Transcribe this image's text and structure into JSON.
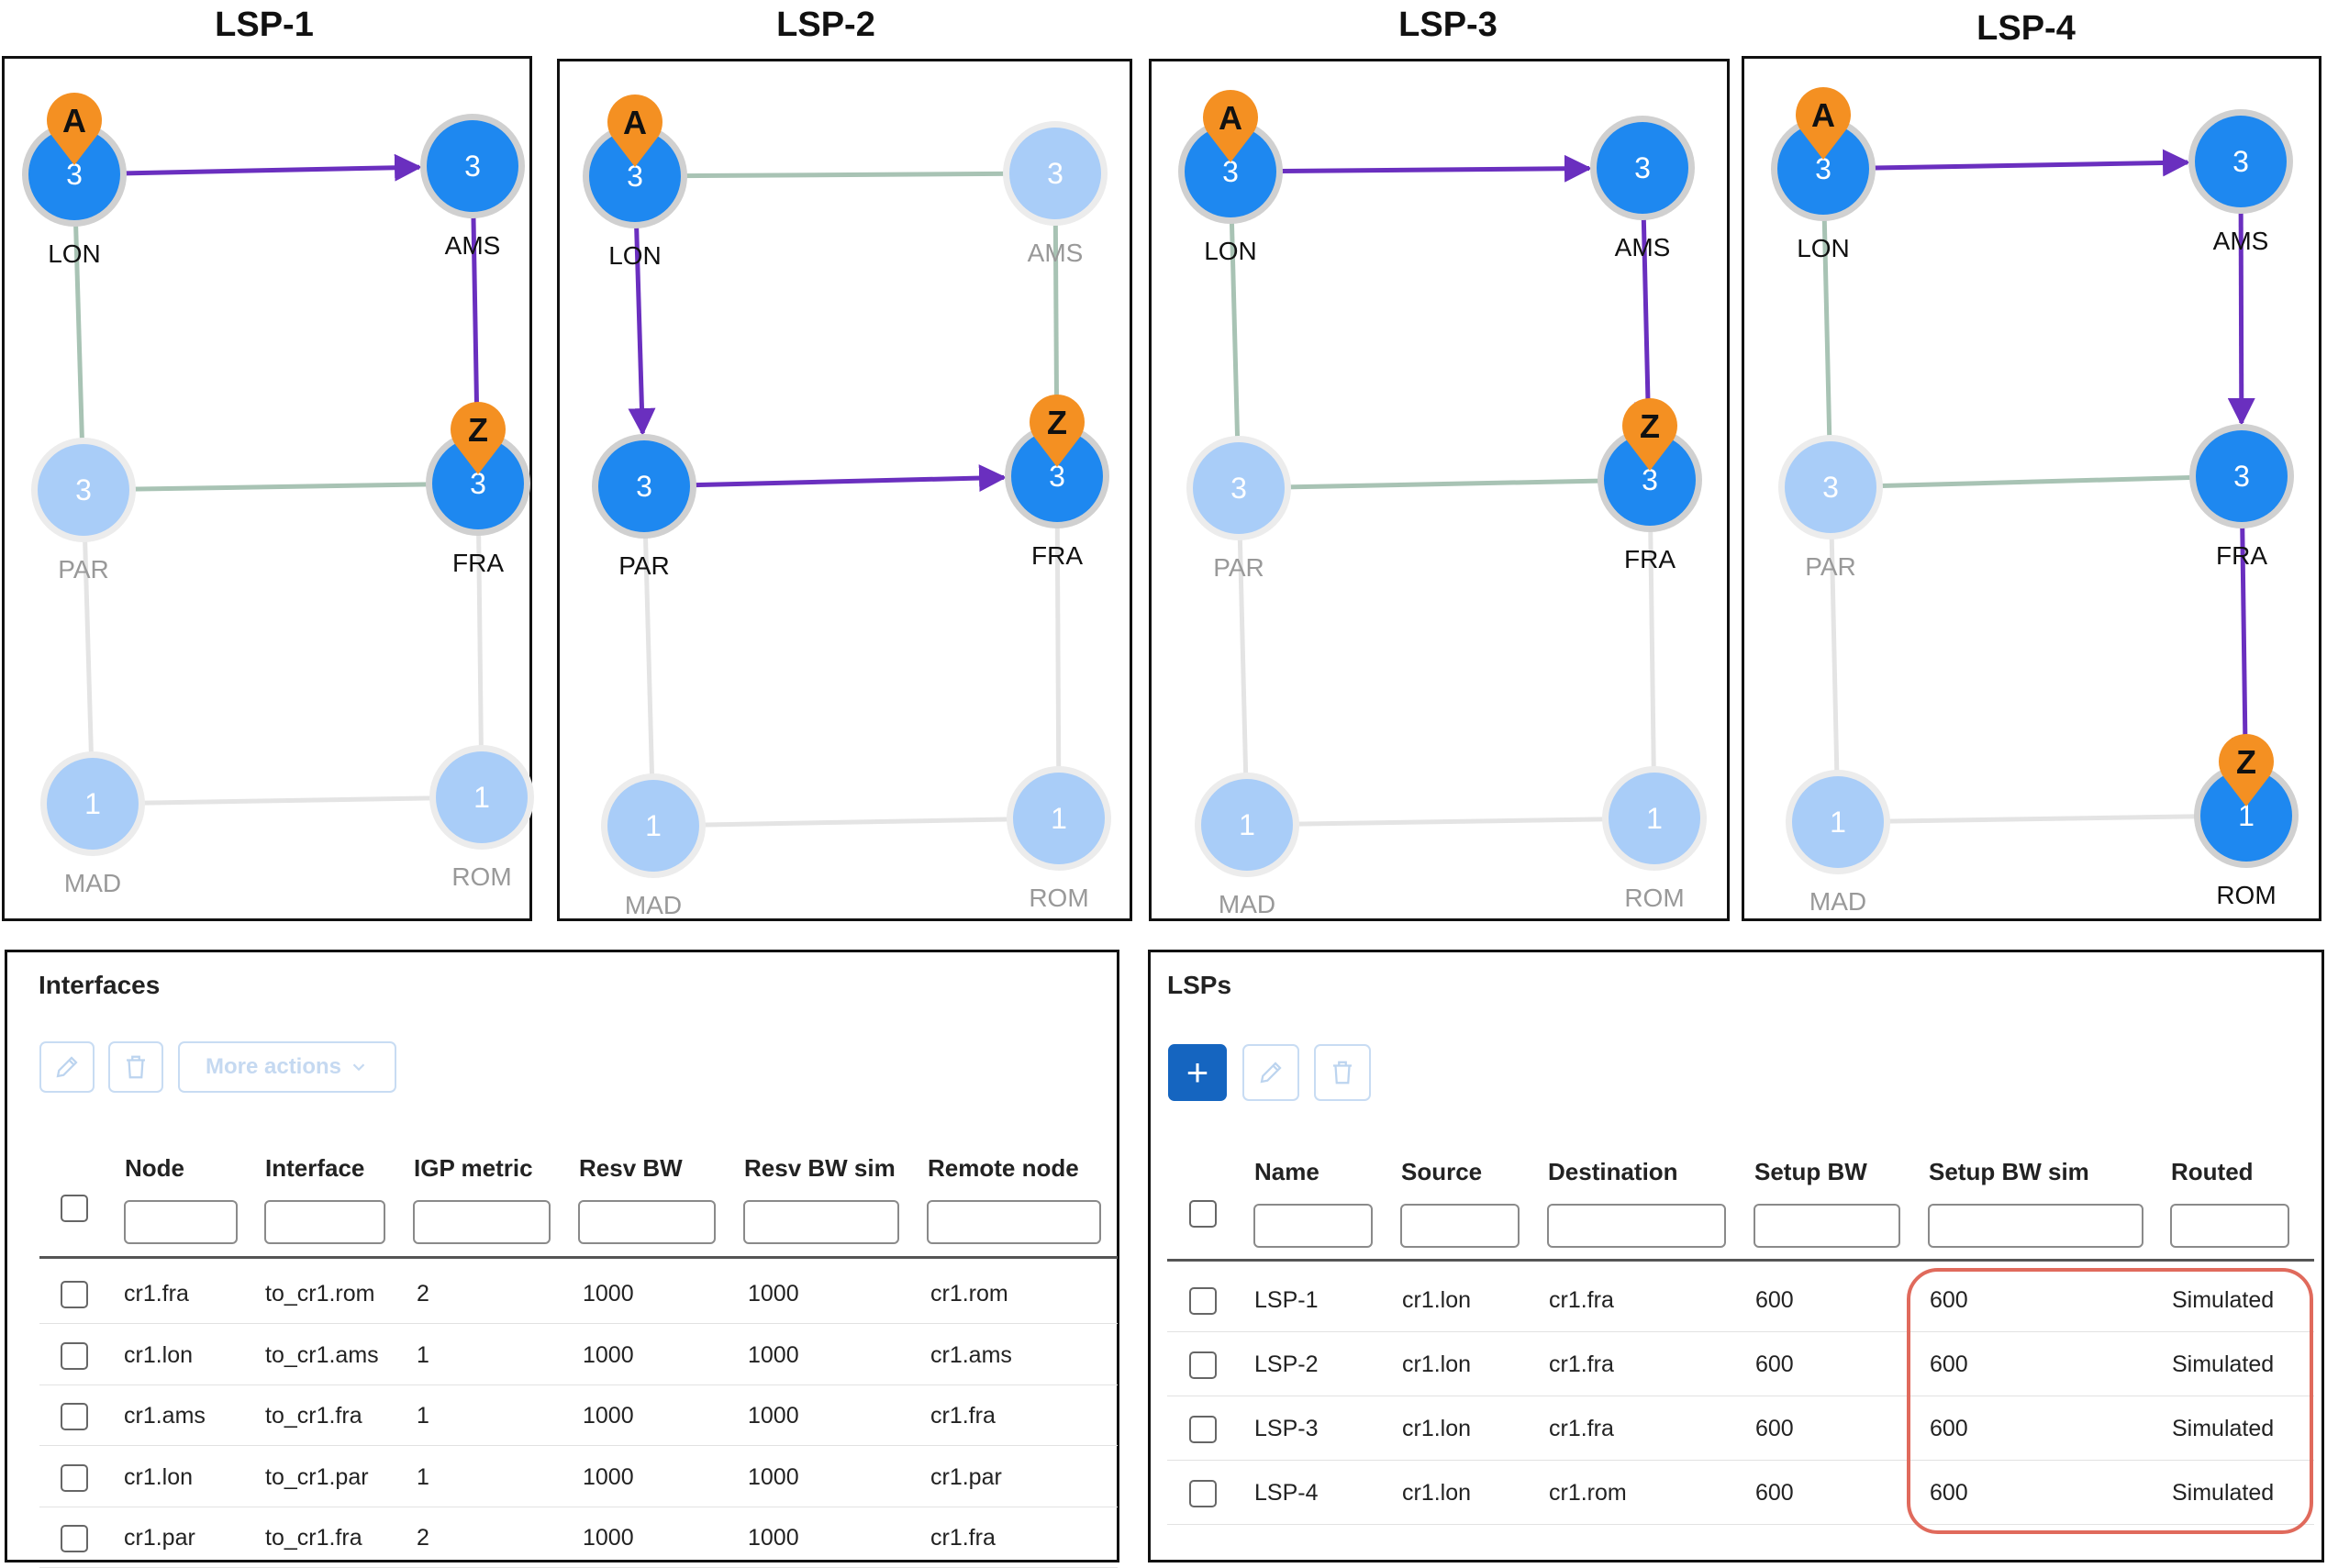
{
  "graphs": [
    {
      "title": "LSP-1",
      "nodes": [
        {
          "name": "LON",
          "value": "3",
          "active": true
        },
        {
          "name": "AMS",
          "value": "3",
          "active": true
        },
        {
          "name": "PAR",
          "value": "3",
          "active": false
        },
        {
          "name": "FRA",
          "value": "3",
          "active": true
        },
        {
          "name": "MAD",
          "value": "1",
          "active": false
        },
        {
          "name": "ROM",
          "value": "1",
          "active": false
        }
      ],
      "path": [
        "LON",
        "AMS",
        "FRA"
      ],
      "start_marker": {
        "label": "A",
        "node": "LON"
      },
      "end_marker": {
        "label": "Z",
        "node": "FRA"
      }
    },
    {
      "title": "LSP-2",
      "nodes": [
        {
          "name": "LON",
          "value": "3",
          "active": true
        },
        {
          "name": "AMS",
          "value": "3",
          "active": false
        },
        {
          "name": "PAR",
          "value": "3",
          "active": true
        },
        {
          "name": "FRA",
          "value": "3",
          "active": true
        },
        {
          "name": "MAD",
          "value": "1",
          "active": false
        },
        {
          "name": "ROM",
          "value": "1",
          "active": false
        }
      ],
      "path": [
        "LON",
        "PAR",
        "FRA"
      ],
      "start_marker": {
        "label": "A",
        "node": "LON"
      },
      "end_marker": {
        "label": "Z",
        "node": "FRA"
      }
    },
    {
      "title": "LSP-3",
      "nodes": [
        {
          "name": "LON",
          "value": "3",
          "active": true
        },
        {
          "name": "AMS",
          "value": "3",
          "active": true
        },
        {
          "name": "PAR",
          "value": "3",
          "active": false
        },
        {
          "name": "FRA",
          "value": "3",
          "active": true
        },
        {
          "name": "MAD",
          "value": "1",
          "active": false
        },
        {
          "name": "ROM",
          "value": "1",
          "active": false
        }
      ],
      "path": [
        "LON",
        "AMS",
        "FRA"
      ],
      "start_marker": {
        "label": "A",
        "node": "LON"
      },
      "end_marker": {
        "label": "Z",
        "node": "FRA"
      }
    },
    {
      "title": "LSP-4",
      "nodes": [
        {
          "name": "LON",
          "value": "3",
          "active": true
        },
        {
          "name": "AMS",
          "value": "3",
          "active": true
        },
        {
          "name": "PAR",
          "value": "3",
          "active": false
        },
        {
          "name": "FRA",
          "value": "3",
          "active": true
        },
        {
          "name": "MAD",
          "value": "1",
          "active": false
        },
        {
          "name": "ROM",
          "value": "1",
          "active": true
        }
      ],
      "path": [
        "LON",
        "AMS",
        "FRA",
        "ROM"
      ],
      "start_marker": {
        "label": "A",
        "node": "LON"
      },
      "end_marker": {
        "label": "Z",
        "node": "ROM"
      }
    }
  ],
  "edges": [
    [
      "LON",
      "AMS"
    ],
    [
      "LON",
      "PAR"
    ],
    [
      "AMS",
      "FRA"
    ],
    [
      "PAR",
      "FRA"
    ],
    [
      "PAR",
      "MAD"
    ],
    [
      "FRA",
      "ROM"
    ],
    [
      "MAD",
      "ROM"
    ]
  ],
  "interfaces": {
    "title": "Interfaces",
    "more_actions_label": "More actions",
    "columns": [
      "Node",
      "Interface",
      "IGP metric",
      "Resv BW",
      "Resv BW sim",
      "Remote node"
    ],
    "rows": [
      [
        "cr1.fra",
        "to_cr1.rom",
        "2",
        "1000",
        "1000",
        "cr1.rom"
      ],
      [
        "cr1.lon",
        "to_cr1.ams",
        "1",
        "1000",
        "1000",
        "cr1.ams"
      ],
      [
        "cr1.ams",
        "to_cr1.fra",
        "1",
        "1000",
        "1000",
        "cr1.fra"
      ],
      [
        "cr1.lon",
        "to_cr1.par",
        "1",
        "1000",
        "1000",
        "cr1.par"
      ],
      [
        "cr1.par",
        "to_cr1.fra",
        "2",
        "1000",
        "1000",
        "cr1.fra"
      ]
    ]
  },
  "lsps": {
    "title": "LSPs",
    "add_label": "+",
    "columns": [
      "Name",
      "Source",
      "Destination",
      "Setup BW",
      "Setup BW sim",
      "Routed"
    ],
    "rows": [
      [
        "LSP-1",
        "cr1.lon",
        "cr1.fra",
        "600",
        "600",
        "Simulated"
      ],
      [
        "LSP-2",
        "cr1.lon",
        "cr1.fra",
        "600",
        "600",
        "Simulated"
      ],
      [
        "LSP-3",
        "cr1.lon",
        "cr1.fra",
        "600",
        "600",
        "Simulated"
      ],
      [
        "LSP-4",
        "cr1.lon",
        "cr1.rom",
        "600",
        "600",
        "Simulated"
      ]
    ]
  },
  "colors": {
    "node_active": "#1e88f0",
    "node_inactive": "#a9cdf8",
    "node_ring": "#d0d0d0",
    "path_arrow": "#6a2fbf",
    "edge_plain": "#e4e4e4",
    "edge_green": "#a8c3b4",
    "marker": "#f49022",
    "label_active": "#111111",
    "label_inactive": "#999999",
    "highlight": "#e06a5c"
  }
}
